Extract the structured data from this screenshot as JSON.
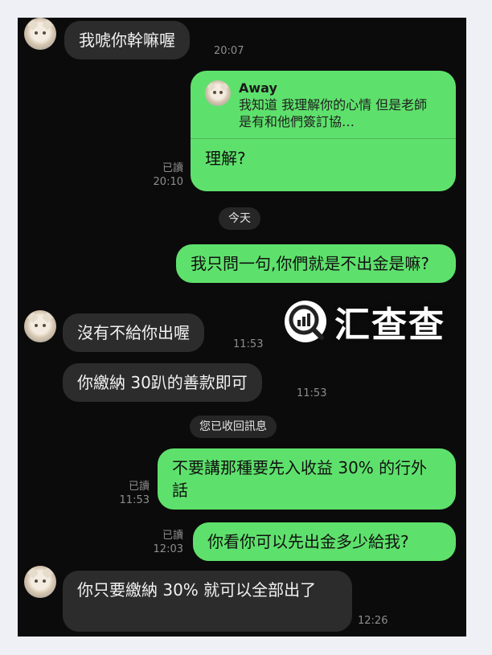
{
  "messages": [
    {
      "text": "我唬你幹嘛喔",
      "time": "20:07"
    },
    {
      "reply_name": "Away",
      "reply_text": "我知道 我理解你的心情 但是老師是有和他們簽訂協…",
      "text": "理解?",
      "read": "已讀",
      "time": "20:10"
    },
    {
      "text": "我只問一句,你們就是不出金是嘛?"
    },
    {
      "text": "沒有不給你出喔",
      "time": "11:53"
    },
    {
      "text": "你繳納 30趴的善款即可",
      "time": "11:53"
    },
    {
      "text": "不要講那種要先入收益 30% 的行外話",
      "read": "已讀",
      "time": "11:53"
    },
    {
      "text": "你看你可以先出金多少給我?",
      "read": "已讀",
      "time": "12:03"
    },
    {
      "text": "你只要繳納 30%  就可以全部出了",
      "time": "12:26"
    }
  ],
  "date_divider": "今天",
  "recalled_notice": "您已收回訊息",
  "watermark": "汇查查",
  "colors": {
    "outgoing": "#5ee16c",
    "incoming": "#2c2c2c",
    "background": "#0b0b0b"
  }
}
